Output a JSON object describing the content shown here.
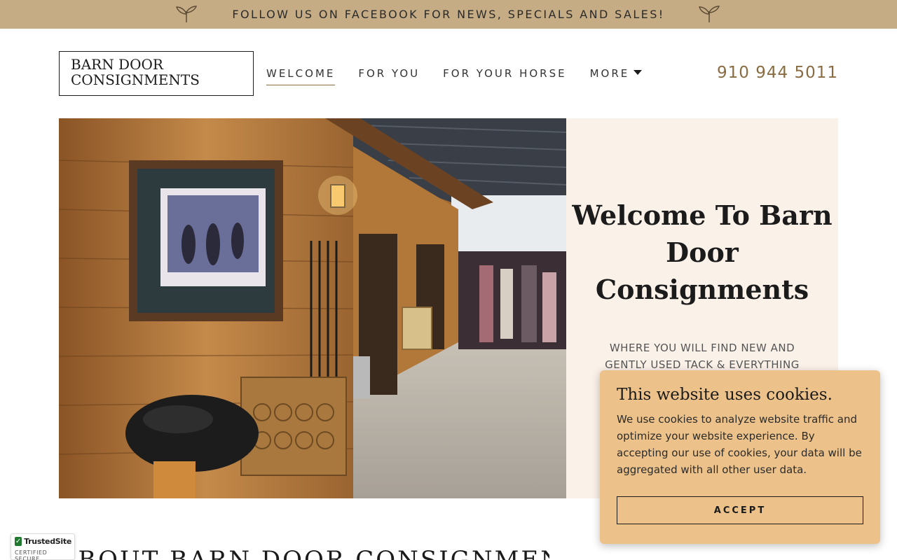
{
  "promo": {
    "text": "FOLLOW US ON FACEBOOK FOR NEWS, SPECIALS AND SALES!",
    "icon": "leaf-sprig-icon"
  },
  "header": {
    "logo_line1": "BARN DOOR",
    "logo_line2": "CONSIGNMENTS",
    "nav": [
      {
        "label": "WELCOME",
        "active": true
      },
      {
        "label": "FOR YOU",
        "active": false
      },
      {
        "label": "FOR YOUR HORSE",
        "active": false
      },
      {
        "label": "MORE",
        "active": false,
        "has_dropdown": true
      }
    ],
    "phone": "910 944 5011"
  },
  "hero": {
    "image_alt": "Interior of Barn Door Consignments store with wood-paneled walls, framed horse racing print, saddle, and racks of horse blankets",
    "title": "Welcome To Barn Door Consignments",
    "subtitle": "WHERE YOU WILL FIND NEW AND GENTLY USED TACK & EVERYTHING"
  },
  "cookie": {
    "title": "This website uses cookies.",
    "text": "We use cookies to analyze website traffic and optimize your website experience. By accepting our use of cookies, your data will be aggregated with all other user data.",
    "button": "ACCEPT"
  },
  "next_section": {
    "heading": "ABOUT BARN DOOR CONSIGNMENTS"
  },
  "trust_badge": {
    "name": "TrustedSite",
    "sub": "CERTIFIED SECURE"
  },
  "colors": {
    "promo_bg": "#c6ac85",
    "accent": "#8a6c43",
    "panel_bg": "#faf1e9",
    "cookie_bg": "#ecc28a"
  }
}
